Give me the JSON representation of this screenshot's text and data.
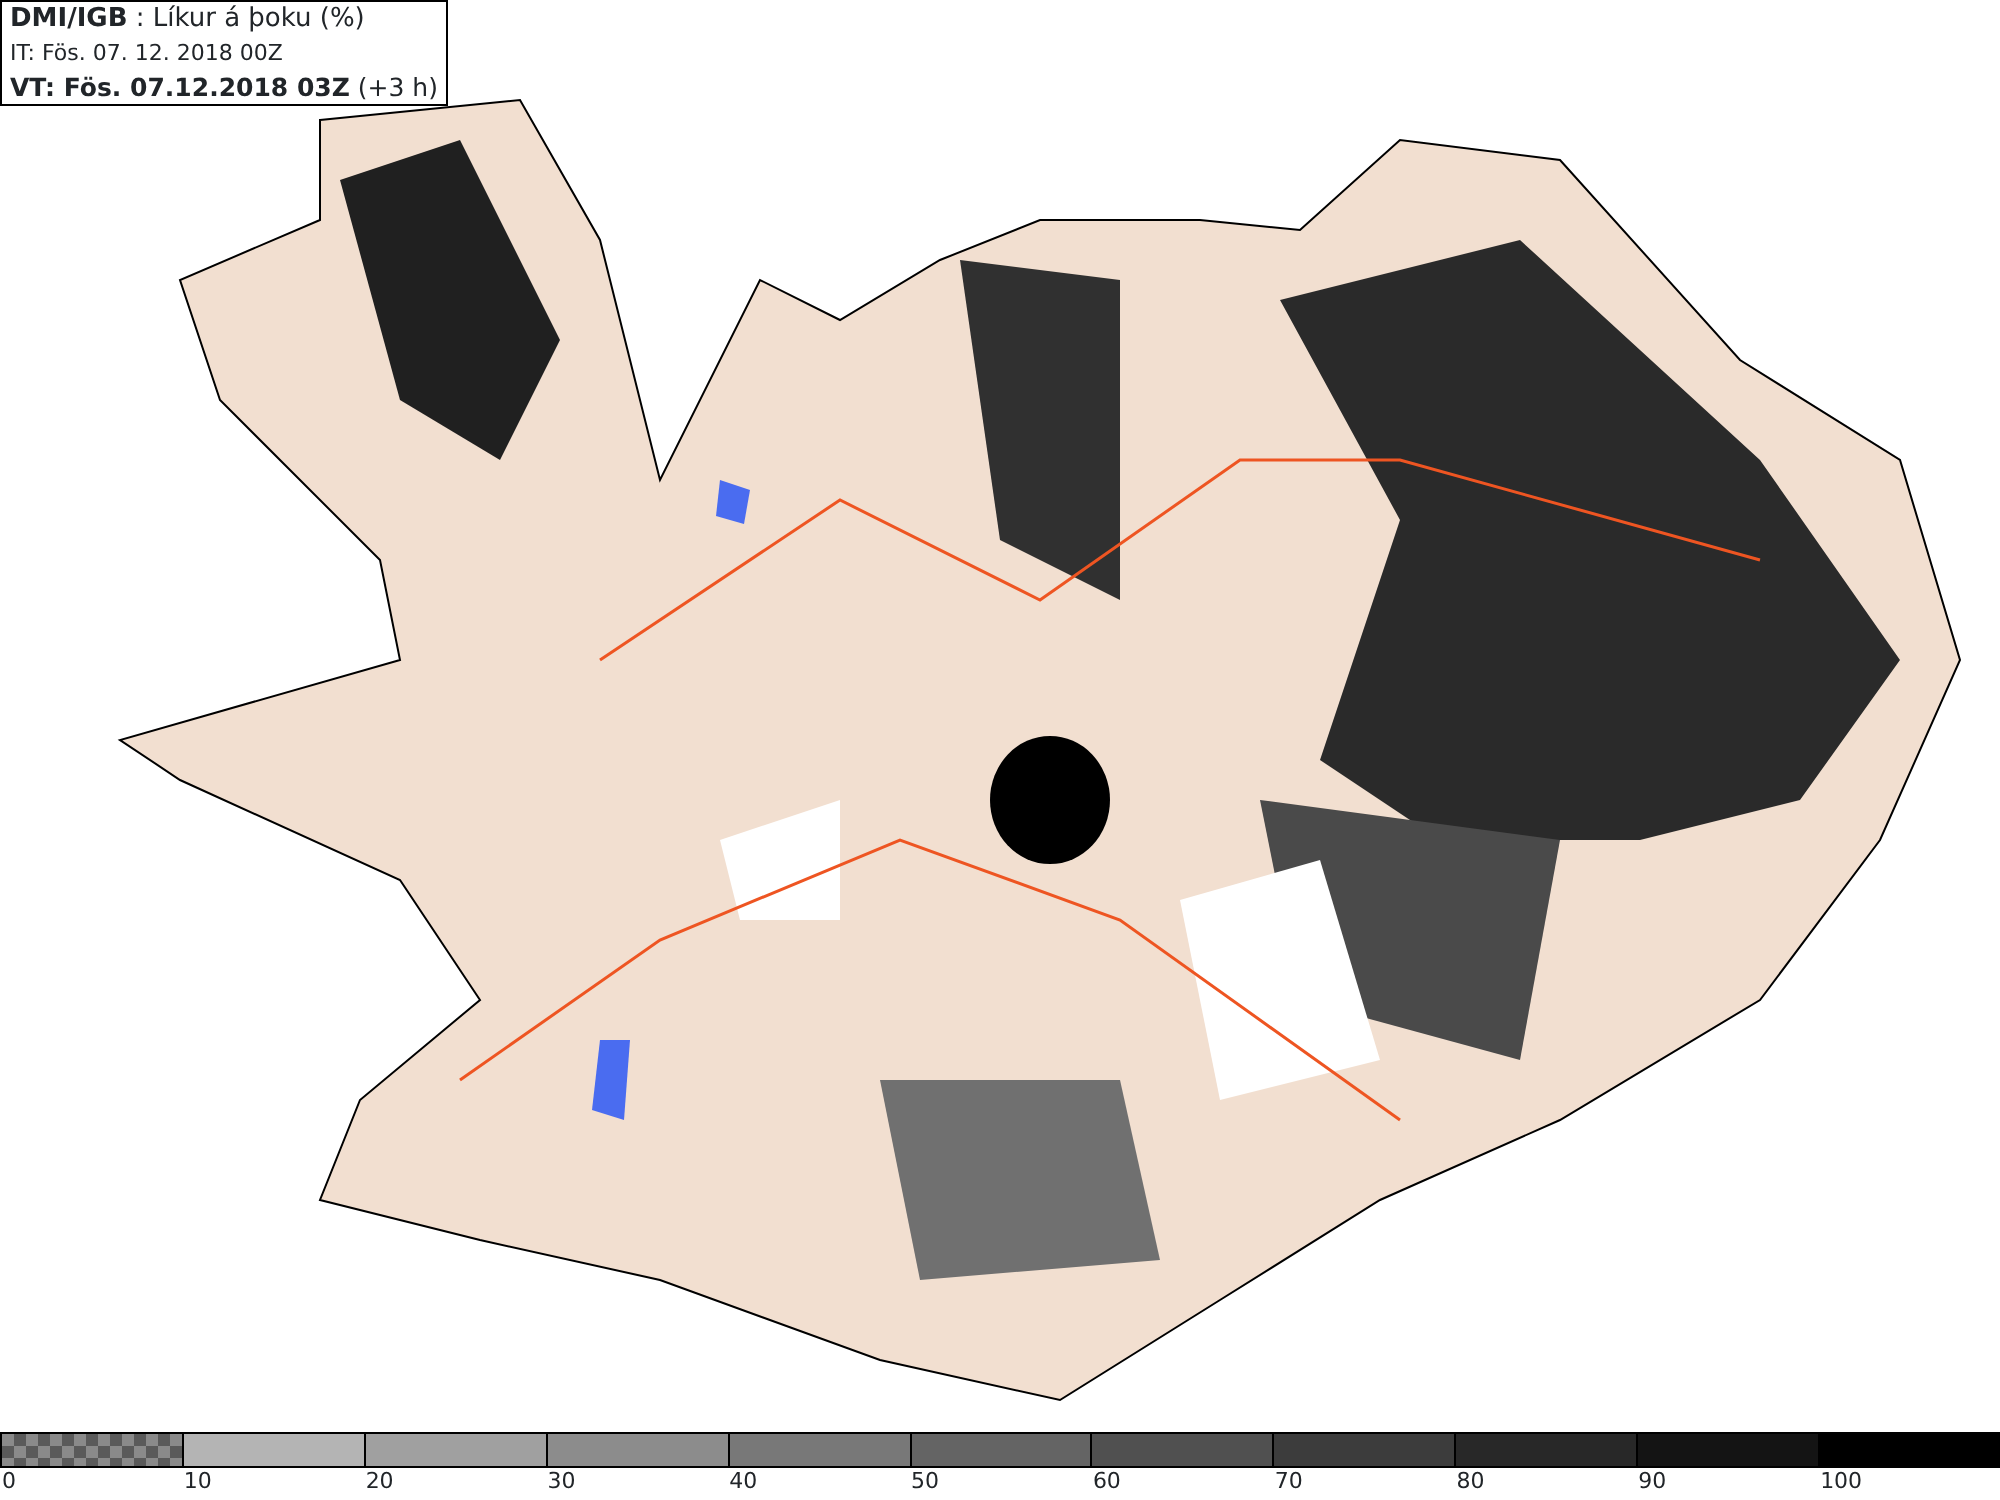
{
  "header": {
    "lines": [
      {
        "text": "**DMI/IGB** : Líkur á þoku (%)"
      },
      {
        "text": "IT: Fös. 07. 12. 2018 00Z"
      },
      {
        "text": "**VT: Fös. 07.12.2018 03Z** (+3 h)"
      }
    ]
  },
  "legend": [
    {
      "label": "0",
      "kind": "checker"
    },
    {
      "label": "10",
      "kind": "solid",
      "color": "#b4b4b4"
    },
    {
      "label": "20",
      "kind": "solid",
      "color": "#a0a0a0"
    },
    {
      "label": "30",
      "kind": "solid",
      "color": "#8c8c8c"
    },
    {
      "label": "40",
      "kind": "solid",
      "color": "#787878"
    },
    {
      "label": "50",
      "kind": "solid",
      "color": "#646464"
    },
    {
      "label": "60",
      "kind": "solid",
      "color": "#505050"
    },
    {
      "label": "70",
      "kind": "solid",
      "color": "#3c3c3c"
    },
    {
      "label": "80",
      "kind": "solid",
      "color": "#282828"
    },
    {
      "label": "90",
      "kind": "solid",
      "color": "#141414"
    },
    {
      "label": "100",
      "kind": "solid",
      "color": "#000000"
    }
  ]
}
